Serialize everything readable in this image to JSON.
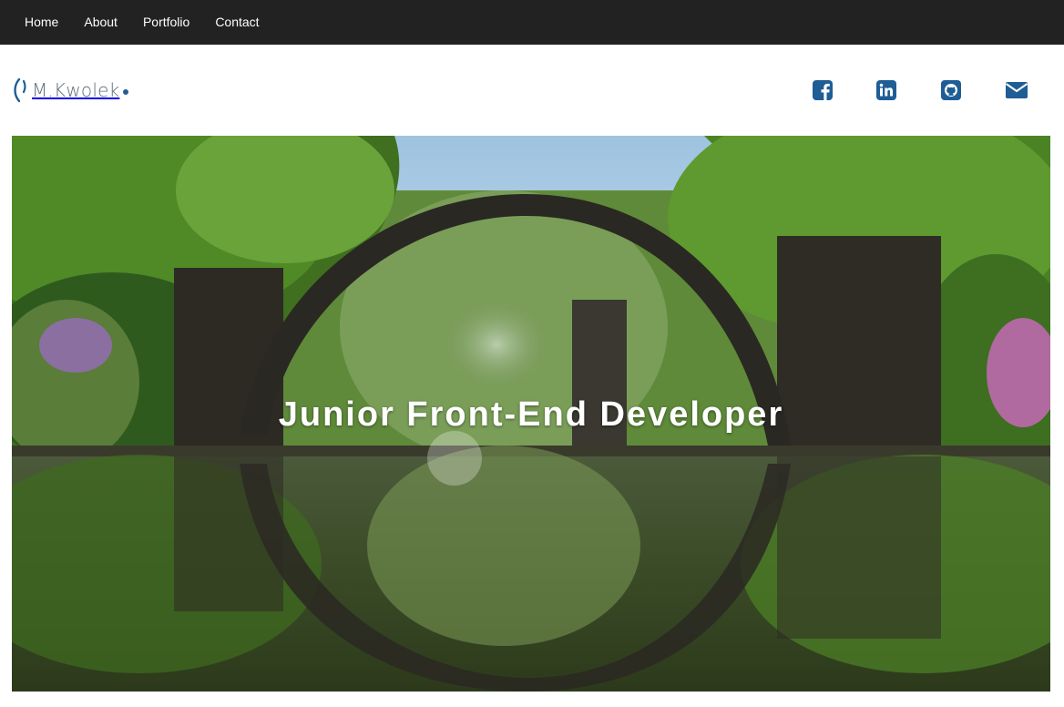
{
  "nav": {
    "items": [
      {
        "label": "Home"
      },
      {
        "label": "About"
      },
      {
        "label": "Portfolio"
      },
      {
        "label": "Contact"
      }
    ]
  },
  "brand": {
    "logo_text": "M.Kwolek",
    "accent_color": "#1f5d95",
    "text_color": "#5d6c7a"
  },
  "social": [
    {
      "icon": "facebook-icon"
    },
    {
      "icon": "linkedin-icon"
    },
    {
      "icon": "github-icon"
    },
    {
      "icon": "envelope-icon"
    }
  ],
  "hero": {
    "title": "Junior Front-End Developer"
  }
}
